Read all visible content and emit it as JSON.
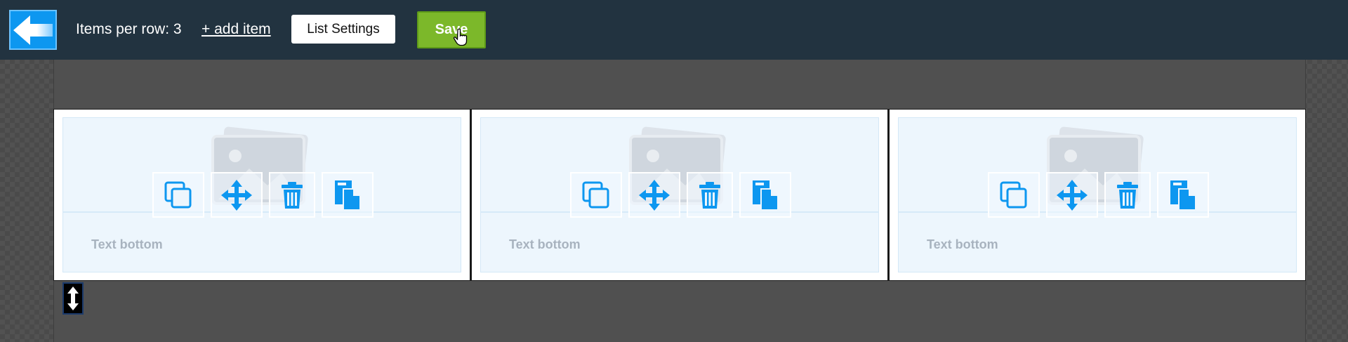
{
  "topbar": {
    "back_icon": "back-arrow-icon",
    "items_per_row_label": "Items per row: 3",
    "add_item_label": "+ add item",
    "list_settings_label": "List Settings",
    "save_label": "Save",
    "save_color": "#7cb82a"
  },
  "colors": {
    "accent": "#0d97f0",
    "topbar_bg": "#223340",
    "card_bg": "#edf6fd"
  },
  "cards": [
    {
      "text": "Text bottom"
    },
    {
      "text": "Text bottom"
    },
    {
      "text": "Text bottom"
    }
  ],
  "toolbar_icons": [
    "duplicate-icon",
    "move-icon",
    "delete-icon",
    "paste-icon"
  ],
  "resize_icon": "vertical-resize-icon"
}
